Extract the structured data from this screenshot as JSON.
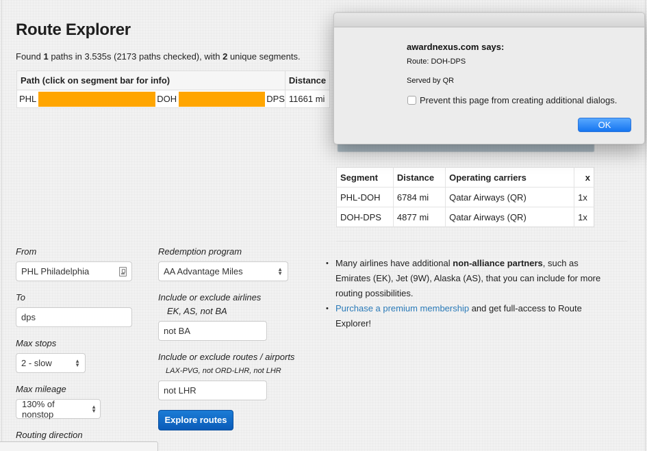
{
  "page": {
    "title": "Route Explorer",
    "summary": {
      "prefix": "Found ",
      "paths_found": "1",
      "middle": " paths in 3.535s (2173 paths checked), with ",
      "unique_segments": "2",
      "suffix": " unique segments."
    }
  },
  "path_table": {
    "headers": {
      "path": "Path (click on segment bar for info)",
      "distance": "Distance"
    },
    "rows": [
      {
        "airports": [
          "PHL",
          "DOH",
          "DPS"
        ],
        "distance": "11661 mi"
      }
    ],
    "segment_bar_color": "#ffa500"
  },
  "segment_table": {
    "headers": [
      "Segment",
      "Distance",
      "Operating carriers",
      "x"
    ],
    "rows": [
      {
        "segment": "PHL-DOH",
        "distance": "6784 mi",
        "carriers": "Qatar Airways (QR)",
        "x": "1x"
      },
      {
        "segment": "DOH-DPS",
        "distance": "4877 mi",
        "carriers": "Qatar Airways (QR)",
        "x": "1x"
      }
    ]
  },
  "form": {
    "from": {
      "label": "From",
      "value": "PHL Philadelphia",
      "icon": "contact-card-icon"
    },
    "to": {
      "label": "To",
      "value": "dps"
    },
    "max_stops": {
      "label": "Max stops",
      "selected": "2 - slow"
    },
    "max_mileage": {
      "label": "Max mileage",
      "selected": "130% of nonstop"
    },
    "routing_direction": {
      "label": "Routing direction"
    },
    "redemption_program": {
      "label": "Redemption program",
      "selected": "AA Advantage Miles"
    },
    "airlines": {
      "label": "Include or exclude airlines",
      "hint": "EK, AS, not BA",
      "value": "not BA"
    },
    "routes": {
      "label": "Include or exclude routes / airports",
      "hint": "LAX-PVG, not ORD-LHR, not LHR",
      "value": "not LHR"
    },
    "submit_label": "Explore routes"
  },
  "info": {
    "item1": {
      "text_before": "Many airlines have additional ",
      "bold": "non-alliance partners",
      "text_after": ", such as Emirates (EK), Jet (9W), Alaska (AS), that you can include for more routing possibilities."
    },
    "item2": {
      "link": "Purchase a premium membership",
      "text_after": " and get full-access to Route Explorer!"
    },
    "link_color": "#2a7ab8"
  },
  "dialog": {
    "heading": "awardnexus.com says:",
    "line1": "Route: DOH-DPS",
    "line2": "Served by QR",
    "checkbox_label": "Prevent this page from creating additional dialogs.",
    "checkbox_checked": false,
    "ok_label": "OK"
  }
}
